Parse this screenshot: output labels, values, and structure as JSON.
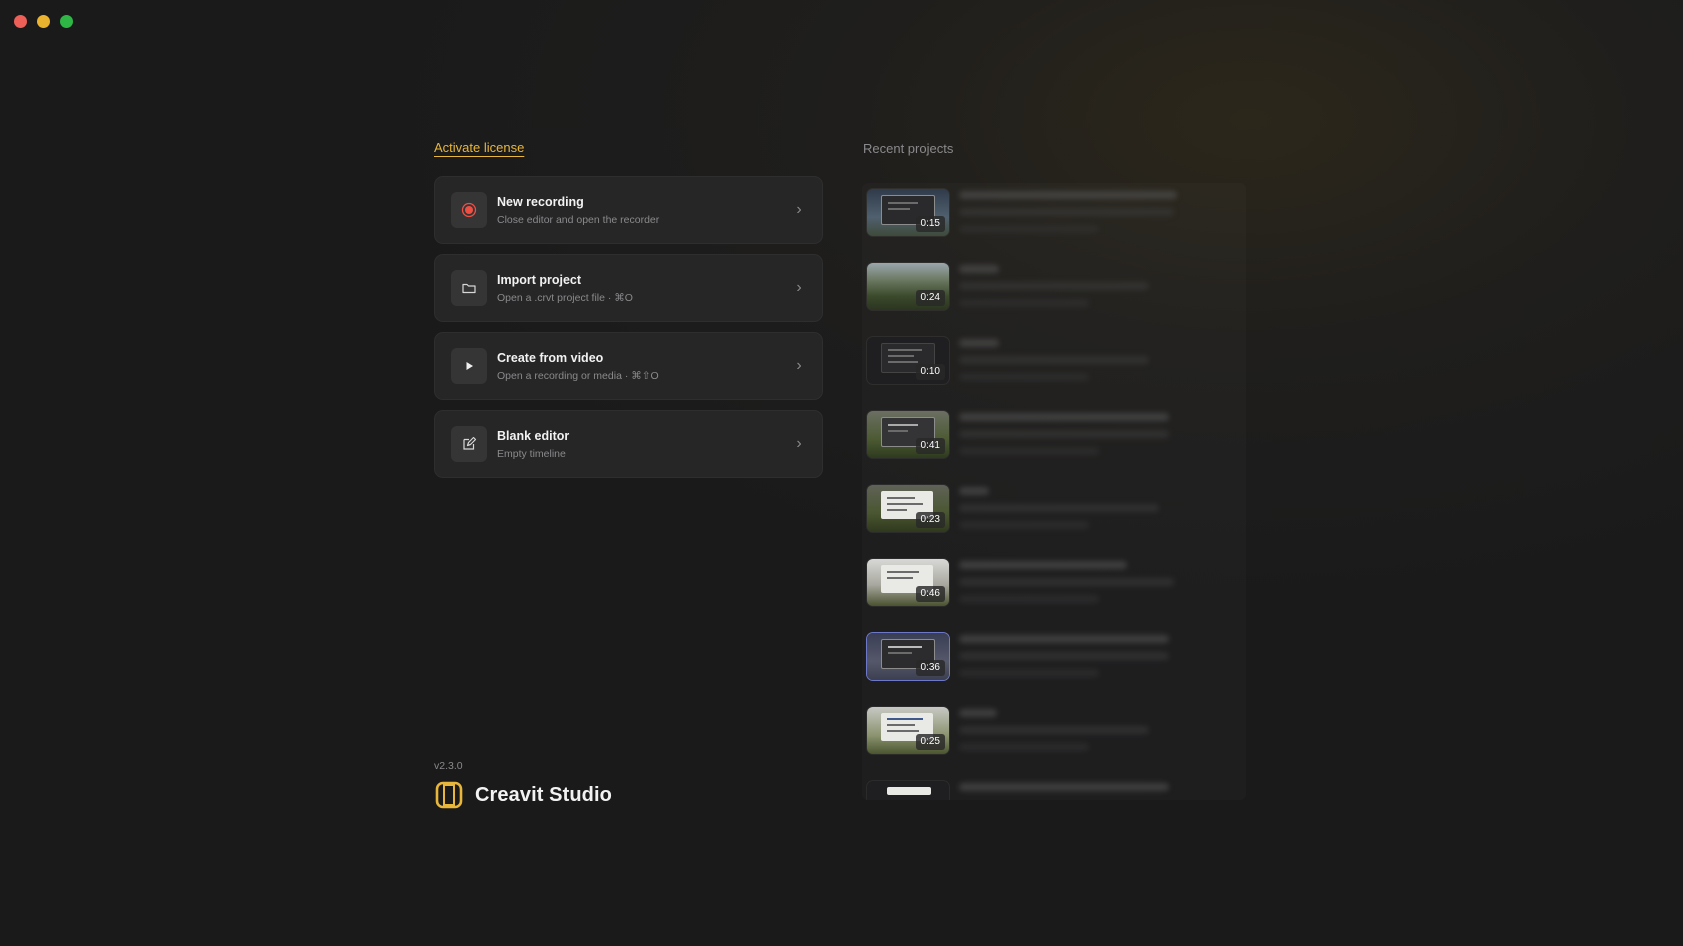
{
  "window": {
    "controls": [
      "close",
      "minimize",
      "maximize"
    ]
  },
  "activate_license": "Activate license",
  "actions": [
    {
      "name": "new-recording",
      "icon": "record-icon",
      "title": "New recording",
      "subtitle": "Close editor and open the recorder"
    },
    {
      "name": "import-project",
      "icon": "folder-icon",
      "title": "Import project",
      "subtitle": "Open a .crvt project file · ⌘O"
    },
    {
      "name": "create-from-video",
      "icon": "play-icon",
      "title": "Create from video",
      "subtitle": "Open a recording or media · ⌘⇧O"
    },
    {
      "name": "blank-editor",
      "icon": "edit-icon",
      "title": "Blank editor",
      "subtitle": "Empty timeline"
    }
  ],
  "version": "v2.3.0",
  "app_name": "Creavit Studio",
  "colors": {
    "accent": "#e8b63a",
    "record": "#ef4f43"
  },
  "recent": {
    "label": "Recent projects",
    "items": [
      {
        "duration": "0:15"
      },
      {
        "duration": "0:24"
      },
      {
        "duration": "0:10"
      },
      {
        "duration": "0:41"
      },
      {
        "duration": "0:23"
      },
      {
        "duration": "0:46"
      },
      {
        "duration": "0:36"
      },
      {
        "duration": "0:25"
      },
      {
        "duration": ""
      }
    ]
  }
}
